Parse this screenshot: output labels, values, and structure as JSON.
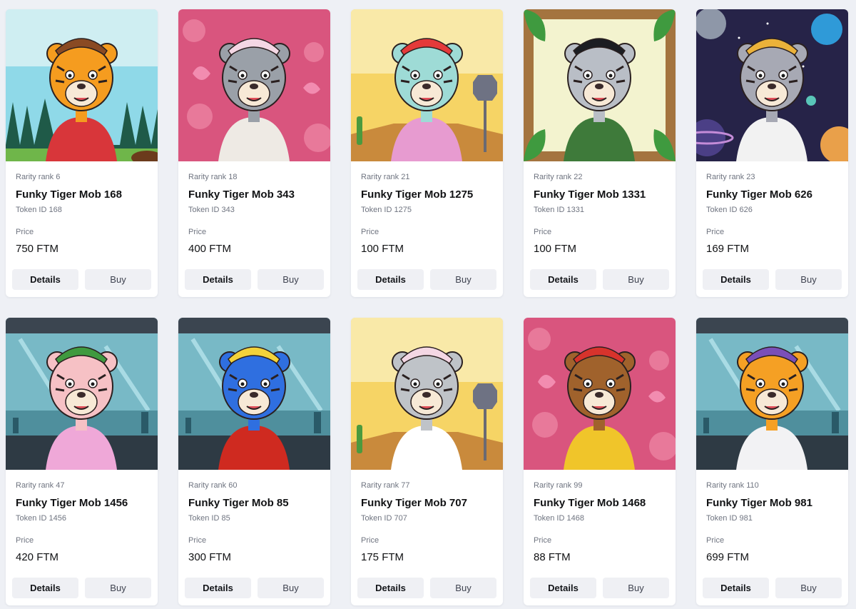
{
  "currency": "FTM",
  "labels": {
    "rarity_prefix": "Rarity rank",
    "token_prefix": "Token ID",
    "price_label": "Price",
    "details_button": "Details",
    "buy_button": "Buy"
  },
  "cards": [
    {
      "rarity": "Rarity rank 6",
      "name": "Funky Tiger Mob 168",
      "token": "Token ID 168",
      "price": "750 FTM",
      "bg": "#8fd9e8",
      "bg2": "#cfeef2",
      "fur": "#f59c1f",
      "shirt": "#d8363a",
      "hat": "#8a4a23",
      "scene": "forest"
    },
    {
      "rarity": "Rarity rank 18",
      "name": "Funky Tiger Mob 343",
      "token": "Token ID 343",
      "price": "400 FTM",
      "bg": "#d9557e",
      "bg2": "#e8799a",
      "fur": "#9aa0a8",
      "shirt": "#eeeae4",
      "hat": "#f4d7e4",
      "scene": "fruit"
    },
    {
      "rarity": "Rarity rank 21",
      "name": "Funky Tiger Mob 1275",
      "token": "Token ID 1275",
      "price": "100 FTM",
      "bg": "#f6d465",
      "bg2": "#f9e9a8",
      "fur": "#9edbd6",
      "shirt": "#e79bd0",
      "hat": "#e43a3a",
      "scene": "road"
    },
    {
      "rarity": "Rarity rank 22",
      "name": "Funky Tiger Mob 1331",
      "token": "Token ID 1331",
      "price": "100 FTM",
      "bg": "#f3f3cf",
      "bg2": "#a4743f",
      "fur": "#b9bec6",
      "shirt": "#3e7a3a",
      "hat": "#1b1d22",
      "scene": "frame"
    },
    {
      "rarity": "Rarity rank 23",
      "name": "Funky Tiger Mob 626",
      "token": "Token ID 626",
      "price": "169 FTM",
      "bg": "#262348",
      "bg2": "#4b3f86",
      "fur": "#a7a9b4",
      "shirt": "#f2f2f2",
      "hat": "#ebb23a",
      "scene": "space"
    },
    {
      "rarity": "Rarity rank 47",
      "name": "Funky Tiger Mob 1456",
      "token": "Token ID 1456",
      "price": "420 FTM",
      "bg": "#78b9c6",
      "bg2": "#4f8f9d",
      "fur": "#f6c1c5",
      "shirt": "#efa8d8",
      "hat": "#3f9a3f",
      "scene": "lab"
    },
    {
      "rarity": "Rarity rank 60",
      "name": "Funky Tiger Mob 85",
      "token": "Token ID 85",
      "price": "300 FTM",
      "bg": "#78b9c6",
      "bg2": "#4f8f9d",
      "fur": "#2f6fe0",
      "shirt": "#cf2a20",
      "hat": "#f3d23a",
      "scene": "lab"
    },
    {
      "rarity": "Rarity rank 77",
      "name": "Funky Tiger Mob 707",
      "token": "Token ID 707",
      "price": "175 FTM",
      "bg": "#f6d465",
      "bg2": "#f9e9a8",
      "fur": "#bfc3c8",
      "shirt": "#ffffff",
      "hat": "#f4d7e4",
      "scene": "road"
    },
    {
      "rarity": "Rarity rank 99",
      "name": "Funky Tiger Mob 1468",
      "token": "Token ID 1468",
      "price": "88 FTM",
      "bg": "#d9557e",
      "bg2": "#e8799a",
      "fur": "#a0622c",
      "shirt": "#f0c52a",
      "hat": "#d7332c",
      "scene": "fruit"
    },
    {
      "rarity": "Rarity rank 110",
      "name": "Funky Tiger Mob 981",
      "token": "Token ID 981",
      "price": "699 FTM",
      "bg": "#78b9c6",
      "bg2": "#4f8f9d",
      "fur": "#f5a024",
      "shirt": "#f2f2f4",
      "hat": "#7a4fb8",
      "scene": "lab"
    }
  ]
}
